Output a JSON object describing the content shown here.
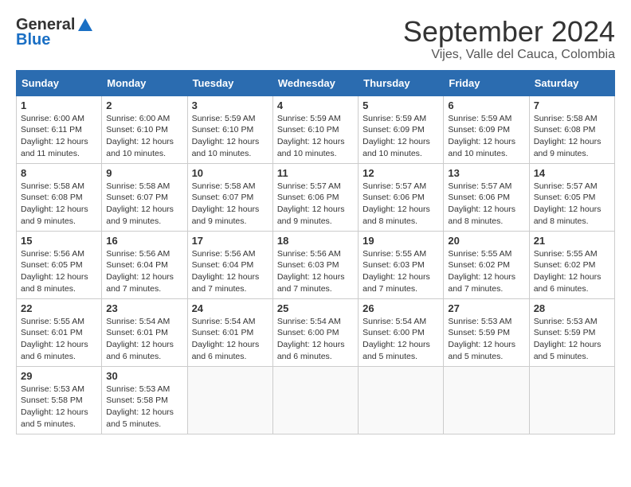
{
  "header": {
    "logo": {
      "general": "General",
      "blue": "Blue"
    },
    "title": "September 2024",
    "subtitle": "Vijes, Valle del Cauca, Colombia"
  },
  "calendar": {
    "days_of_week": [
      "Sunday",
      "Monday",
      "Tuesday",
      "Wednesday",
      "Thursday",
      "Friday",
      "Saturday"
    ],
    "weeks": [
      [
        {
          "day": "1",
          "sunrise": "Sunrise: 6:00 AM",
          "sunset": "Sunset: 6:11 PM",
          "daylight": "Daylight: 12 hours and 11 minutes."
        },
        {
          "day": "2",
          "sunrise": "Sunrise: 6:00 AM",
          "sunset": "Sunset: 6:10 PM",
          "daylight": "Daylight: 12 hours and 10 minutes."
        },
        {
          "day": "3",
          "sunrise": "Sunrise: 5:59 AM",
          "sunset": "Sunset: 6:10 PM",
          "daylight": "Daylight: 12 hours and 10 minutes."
        },
        {
          "day": "4",
          "sunrise": "Sunrise: 5:59 AM",
          "sunset": "Sunset: 6:10 PM",
          "daylight": "Daylight: 12 hours and 10 minutes."
        },
        {
          "day": "5",
          "sunrise": "Sunrise: 5:59 AM",
          "sunset": "Sunset: 6:09 PM",
          "daylight": "Daylight: 12 hours and 10 minutes."
        },
        {
          "day": "6",
          "sunrise": "Sunrise: 5:59 AM",
          "sunset": "Sunset: 6:09 PM",
          "daylight": "Daylight: 12 hours and 10 minutes."
        },
        {
          "day": "7",
          "sunrise": "Sunrise: 5:58 AM",
          "sunset": "Sunset: 6:08 PM",
          "daylight": "Daylight: 12 hours and 9 minutes."
        }
      ],
      [
        {
          "day": "8",
          "sunrise": "Sunrise: 5:58 AM",
          "sunset": "Sunset: 6:08 PM",
          "daylight": "Daylight: 12 hours and 9 minutes."
        },
        {
          "day": "9",
          "sunrise": "Sunrise: 5:58 AM",
          "sunset": "Sunset: 6:07 PM",
          "daylight": "Daylight: 12 hours and 9 minutes."
        },
        {
          "day": "10",
          "sunrise": "Sunrise: 5:58 AM",
          "sunset": "Sunset: 6:07 PM",
          "daylight": "Daylight: 12 hours and 9 minutes."
        },
        {
          "day": "11",
          "sunrise": "Sunrise: 5:57 AM",
          "sunset": "Sunset: 6:06 PM",
          "daylight": "Daylight: 12 hours and 9 minutes."
        },
        {
          "day": "12",
          "sunrise": "Sunrise: 5:57 AM",
          "sunset": "Sunset: 6:06 PM",
          "daylight": "Daylight: 12 hours and 8 minutes."
        },
        {
          "day": "13",
          "sunrise": "Sunrise: 5:57 AM",
          "sunset": "Sunset: 6:06 PM",
          "daylight": "Daylight: 12 hours and 8 minutes."
        },
        {
          "day": "14",
          "sunrise": "Sunrise: 5:57 AM",
          "sunset": "Sunset: 6:05 PM",
          "daylight": "Daylight: 12 hours and 8 minutes."
        }
      ],
      [
        {
          "day": "15",
          "sunrise": "Sunrise: 5:56 AM",
          "sunset": "Sunset: 6:05 PM",
          "daylight": "Daylight: 12 hours and 8 minutes."
        },
        {
          "day": "16",
          "sunrise": "Sunrise: 5:56 AM",
          "sunset": "Sunset: 6:04 PM",
          "daylight": "Daylight: 12 hours and 7 minutes."
        },
        {
          "day": "17",
          "sunrise": "Sunrise: 5:56 AM",
          "sunset": "Sunset: 6:04 PM",
          "daylight": "Daylight: 12 hours and 7 minutes."
        },
        {
          "day": "18",
          "sunrise": "Sunrise: 5:56 AM",
          "sunset": "Sunset: 6:03 PM",
          "daylight": "Daylight: 12 hours and 7 minutes."
        },
        {
          "day": "19",
          "sunrise": "Sunrise: 5:55 AM",
          "sunset": "Sunset: 6:03 PM",
          "daylight": "Daylight: 12 hours and 7 minutes."
        },
        {
          "day": "20",
          "sunrise": "Sunrise: 5:55 AM",
          "sunset": "Sunset: 6:02 PM",
          "daylight": "Daylight: 12 hours and 7 minutes."
        },
        {
          "day": "21",
          "sunrise": "Sunrise: 5:55 AM",
          "sunset": "Sunset: 6:02 PM",
          "daylight": "Daylight: 12 hours and 6 minutes."
        }
      ],
      [
        {
          "day": "22",
          "sunrise": "Sunrise: 5:55 AM",
          "sunset": "Sunset: 6:01 PM",
          "daylight": "Daylight: 12 hours and 6 minutes."
        },
        {
          "day": "23",
          "sunrise": "Sunrise: 5:54 AM",
          "sunset": "Sunset: 6:01 PM",
          "daylight": "Daylight: 12 hours and 6 minutes."
        },
        {
          "day": "24",
          "sunrise": "Sunrise: 5:54 AM",
          "sunset": "Sunset: 6:01 PM",
          "daylight": "Daylight: 12 hours and 6 minutes."
        },
        {
          "day": "25",
          "sunrise": "Sunrise: 5:54 AM",
          "sunset": "Sunset: 6:00 PM",
          "daylight": "Daylight: 12 hours and 6 minutes."
        },
        {
          "day": "26",
          "sunrise": "Sunrise: 5:54 AM",
          "sunset": "Sunset: 6:00 PM",
          "daylight": "Daylight: 12 hours and 5 minutes."
        },
        {
          "day": "27",
          "sunrise": "Sunrise: 5:53 AM",
          "sunset": "Sunset: 5:59 PM",
          "daylight": "Daylight: 12 hours and 5 minutes."
        },
        {
          "day": "28",
          "sunrise": "Sunrise: 5:53 AM",
          "sunset": "Sunset: 5:59 PM",
          "daylight": "Daylight: 12 hours and 5 minutes."
        }
      ],
      [
        {
          "day": "29",
          "sunrise": "Sunrise: 5:53 AM",
          "sunset": "Sunset: 5:58 PM",
          "daylight": "Daylight: 12 hours and 5 minutes."
        },
        {
          "day": "30",
          "sunrise": "Sunrise: 5:53 AM",
          "sunset": "Sunset: 5:58 PM",
          "daylight": "Daylight: 12 hours and 5 minutes."
        },
        {
          "day": "",
          "sunrise": "",
          "sunset": "",
          "daylight": ""
        },
        {
          "day": "",
          "sunrise": "",
          "sunset": "",
          "daylight": ""
        },
        {
          "day": "",
          "sunrise": "",
          "sunset": "",
          "daylight": ""
        },
        {
          "day": "",
          "sunrise": "",
          "sunset": "",
          "daylight": ""
        },
        {
          "day": "",
          "sunrise": "",
          "sunset": "",
          "daylight": ""
        }
      ]
    ]
  }
}
